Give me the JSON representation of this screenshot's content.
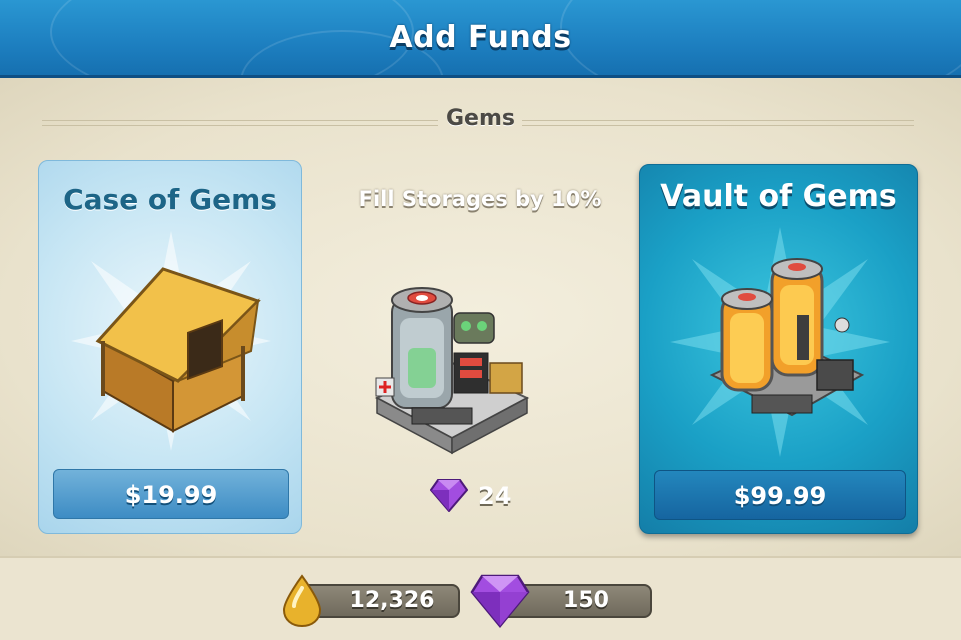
{
  "header": {
    "title": "Add Funds"
  },
  "section": {
    "title": "Gems"
  },
  "offers": {
    "left": {
      "title": "Case of Gems",
      "price": "$19.99",
      "icon": "tent-icon"
    },
    "middle": {
      "title": "Fill Storages by 10%",
      "cost": "24",
      "icon": "storage-building-icon"
    },
    "right": {
      "title": "Vault of Gems",
      "price": "$99.99",
      "icon": "gem-vault-icon"
    }
  },
  "resources": {
    "gold": {
      "value": "12,326",
      "icon": "gold-drop-icon"
    },
    "gems": {
      "value": "150",
      "icon": "gem-icon"
    }
  },
  "colors": {
    "header": "#1d7fc0",
    "accent": "#1aa0c6",
    "gem": "#9b3fd6",
    "gold": "#e8b22c"
  }
}
